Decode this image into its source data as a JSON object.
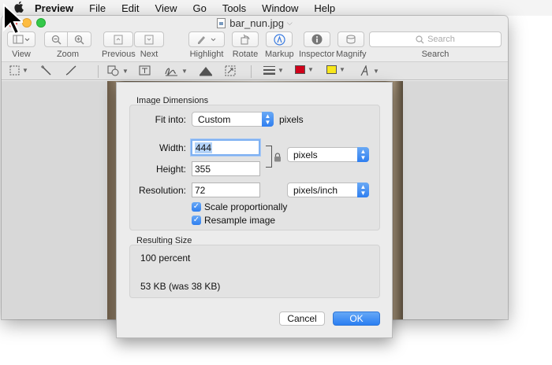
{
  "menubar": {
    "apple": "",
    "items": [
      "Preview",
      "File",
      "Edit",
      "View",
      "Go",
      "Tools",
      "Window",
      "Help"
    ]
  },
  "window": {
    "title": "bar_nun.jpg"
  },
  "toolbar": {
    "view_label": "View",
    "zoom_label": "Zoom",
    "previous_label": "Previous",
    "next_label": "Next",
    "highlight_label": "Highlight",
    "rotate_label": "Rotate",
    "markup_label": "Markup",
    "inspector_label": "Inspector",
    "magnify_label": "Magnify",
    "search_placeholder": "Search",
    "search_label": "Search"
  },
  "markup_colors": {
    "border_color": "#d0021b",
    "fill_color": "#f8e71c"
  },
  "dialog": {
    "image_dimensions_title": "Image Dimensions",
    "fit_into_label": "Fit into:",
    "fit_into_value": "Custom",
    "fit_into_unit": "pixels",
    "width_label": "Width:",
    "width_value": "444",
    "height_label": "Height:",
    "height_value": "355",
    "size_unit": "pixels",
    "resolution_label": "Resolution:",
    "resolution_value": "72",
    "resolution_unit": "pixels/inch",
    "scale_proportionally": "Scale proportionally",
    "resample_image": "Resample image",
    "resulting_size_title": "Resulting Size",
    "result_percent": "100 percent",
    "result_size": "53 KB (was 38 KB)",
    "cancel_label": "Cancel",
    "ok_label": "OK"
  }
}
